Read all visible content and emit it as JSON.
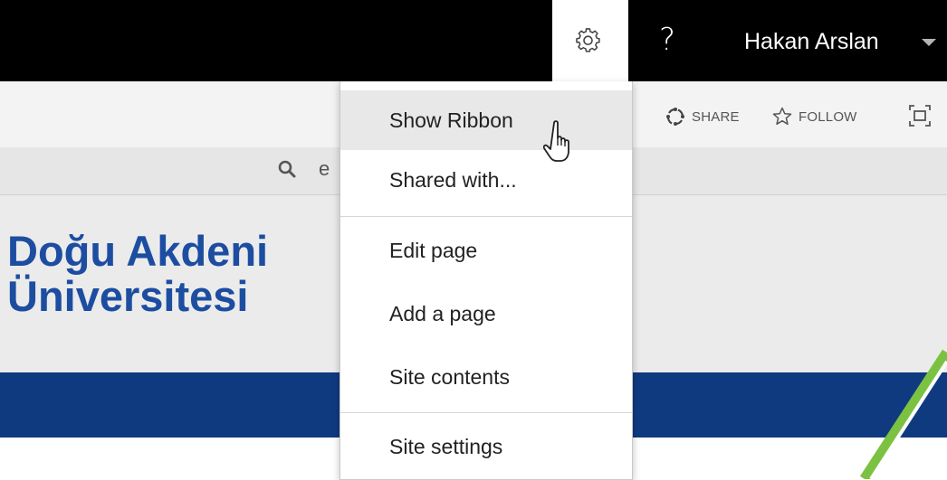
{
  "suite_bar": {
    "help_label": "?",
    "user_name": "Hakan Arslan"
  },
  "action_bar": {
    "share_label": "SHARE",
    "follow_label": "FOLLOW"
  },
  "search": {
    "visible_text": "e"
  },
  "site": {
    "title_line1": "Doğu Akdeni",
    "title_line2": "Üniversitesi"
  },
  "settings_menu": {
    "items": [
      {
        "label": "Show Ribbon",
        "hovered": true
      },
      {
        "label": "Shared with..."
      },
      {
        "label": "Edit page"
      },
      {
        "label": "Add a page"
      },
      {
        "label": "Site contents"
      },
      {
        "label": "Site settings"
      }
    ]
  },
  "icons": {
    "settings": "gear-icon",
    "help": "help-icon",
    "user_menu": "chevron-down-icon",
    "share": "share-icon",
    "follow": "star-icon",
    "focus": "focus-mode-icon",
    "search": "search-icon",
    "pointer": "hand-cursor-icon"
  },
  "colors": {
    "suite_bar": "#000000",
    "site_title": "#1c4da1",
    "nav_bar": "#103a80",
    "accent_stroke": "#7cc242",
    "menu_hover": "#e8e8e8"
  }
}
